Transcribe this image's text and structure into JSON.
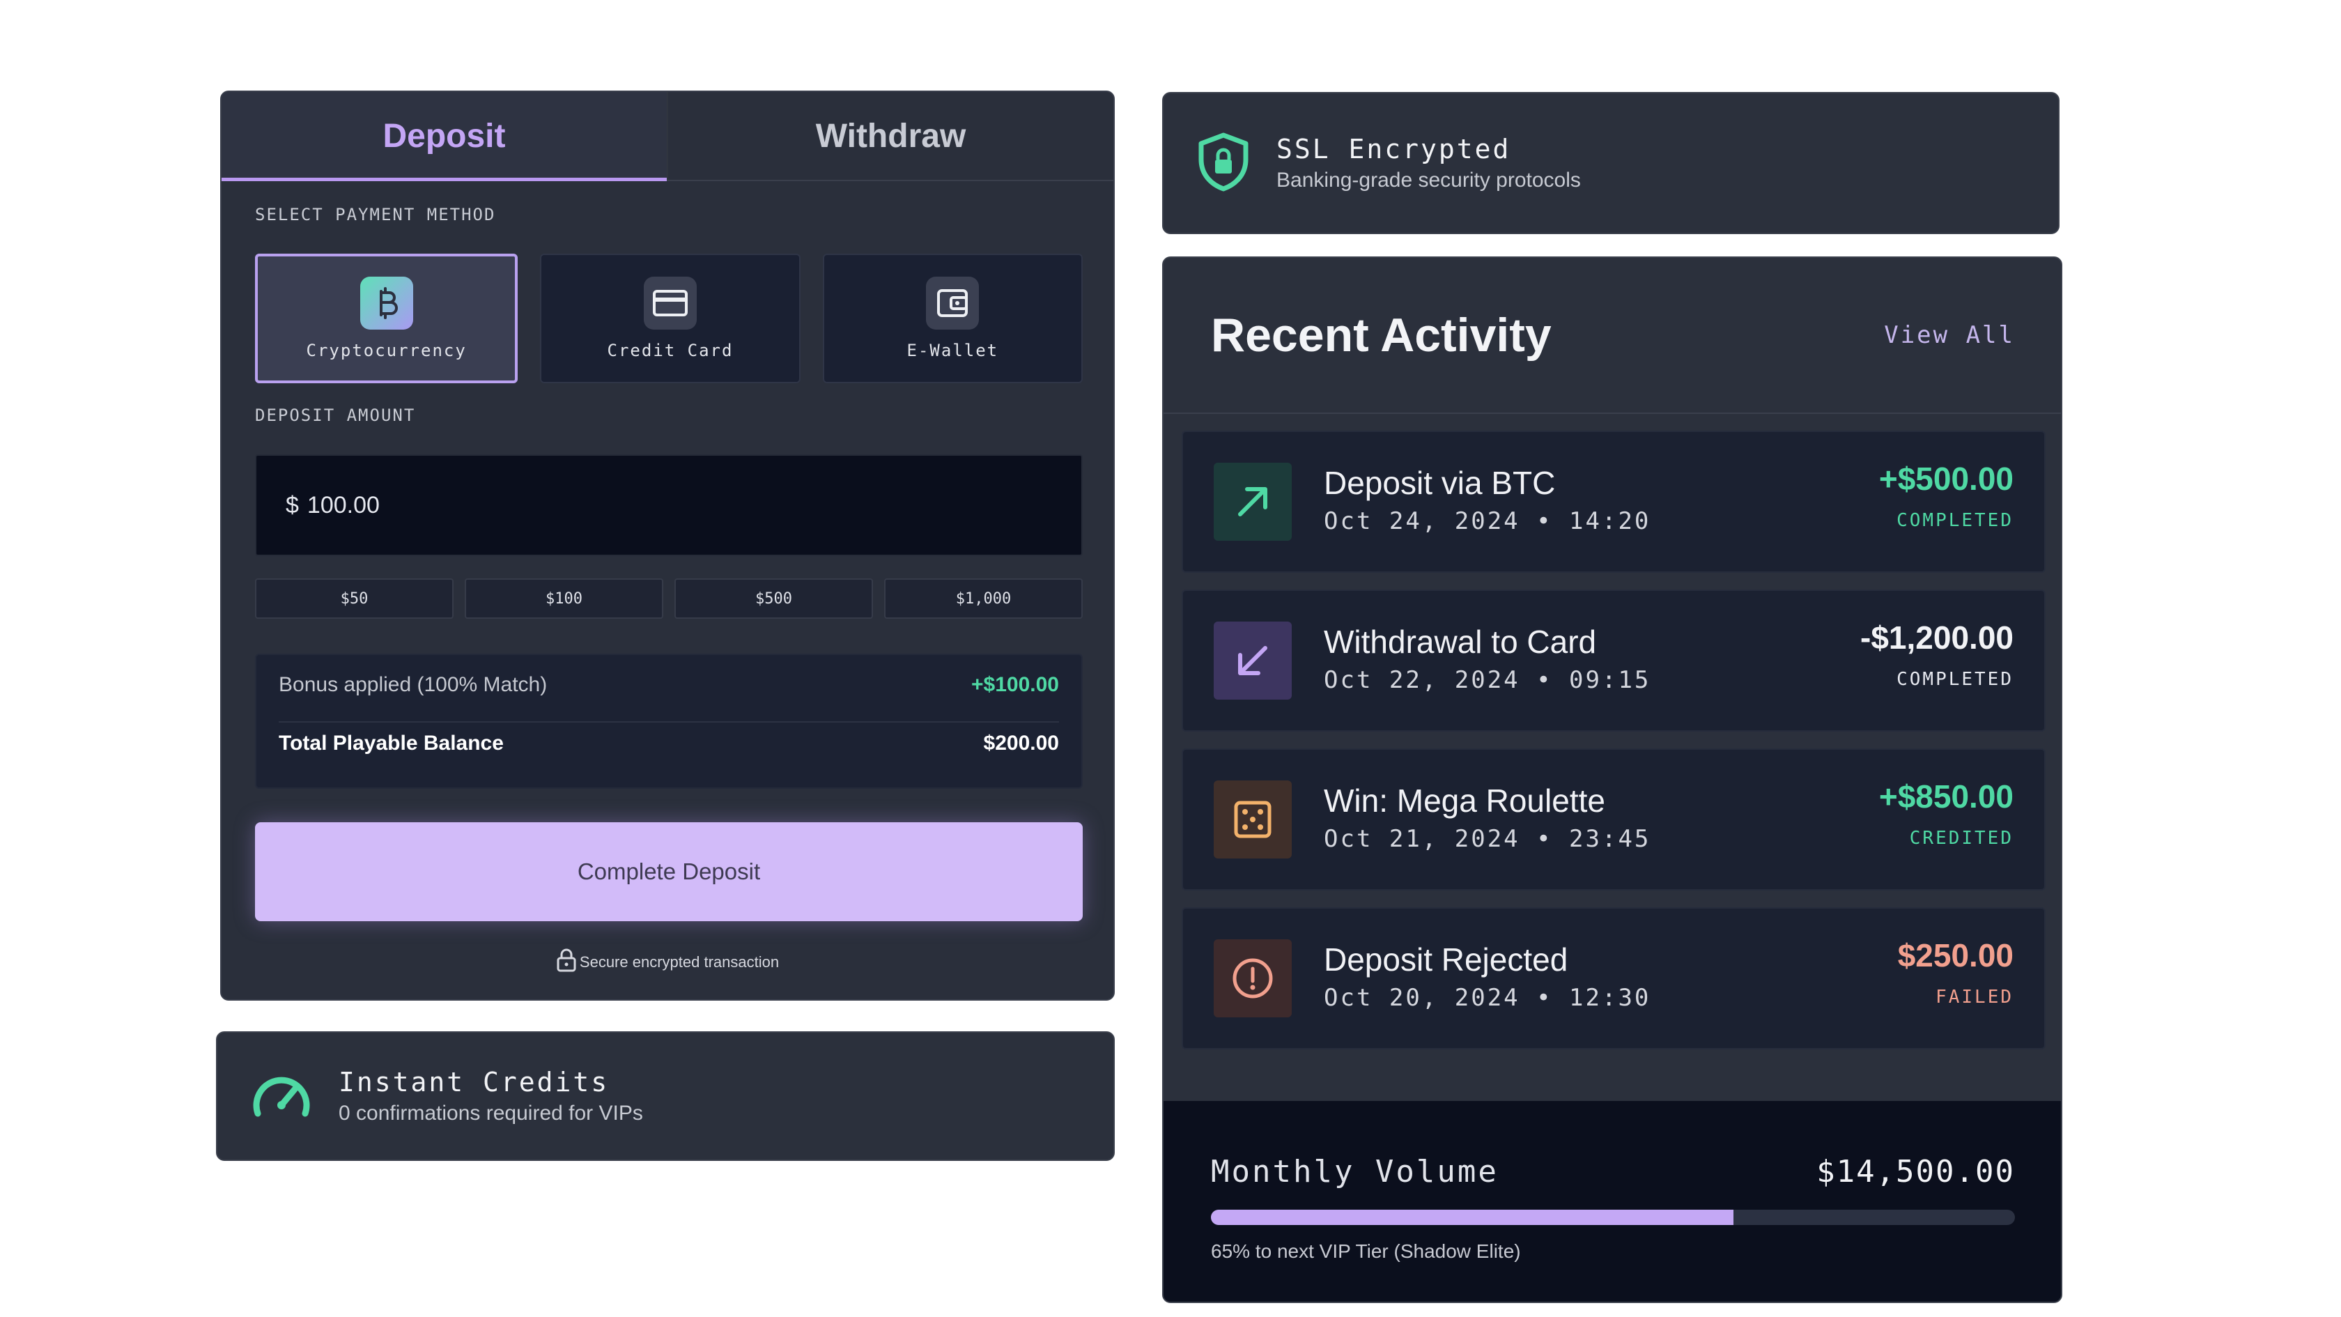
{
  "tabs": {
    "deposit": "Deposit",
    "withdraw": "Withdraw"
  },
  "payment": {
    "label": "SELECT PAYMENT METHOD",
    "methods": [
      {
        "label": "Cryptocurrency",
        "icon": "bitcoin-icon",
        "selected": true
      },
      {
        "label": "Credit Card",
        "icon": "credit-card-icon",
        "selected": false
      },
      {
        "label": "E-Wallet",
        "icon": "wallet-icon",
        "selected": false
      }
    ]
  },
  "amount": {
    "label": "DEPOSIT AMOUNT",
    "currency": "$",
    "value": "100.00",
    "quick": [
      "$50",
      "$100",
      "$500",
      "$1,000"
    ]
  },
  "summary": {
    "bonus_label": "Bonus applied (100% Match)",
    "bonus_value": "+$100.00",
    "total_label": "Total Playable Balance",
    "total_value": "$200.00"
  },
  "cta": "Complete Deposit",
  "secure_note": "Secure encrypted transaction",
  "instant": {
    "title": "Instant Credits",
    "subtitle": "0 confirmations required for VIPs",
    "icon": "speedometer-icon"
  },
  "ssl": {
    "title": "SSL Encrypted",
    "subtitle": "Banking-grade security protocols",
    "icon": "shield-lock-icon"
  },
  "activity": {
    "title": "Recent Activity",
    "view_all": "View All",
    "items": [
      {
        "title": "Deposit via BTC",
        "date": "Oct 24, 2024 • 14:20",
        "amount": "+$500.00",
        "status": "COMPLETED",
        "icon": "arrow-up-right-icon",
        "color": "#4fd9a4"
      },
      {
        "title": "Withdrawal to Card",
        "date": "Oct 22, 2024 • 09:15",
        "amount": "-$1,200.00",
        "status": "COMPLETED",
        "icon": "arrow-down-left-icon",
        "color": "#f2f3f6"
      },
      {
        "title": "Win: Mega Roulette",
        "date": "Oct 21, 2024 • 23:45",
        "amount": "+$850.00",
        "status": "CREDITED",
        "icon": "dice-icon",
        "color": "#4fd9a4"
      },
      {
        "title": "Deposit Rejected",
        "date": "Oct 20, 2024 • 12:30",
        "amount": "$250.00",
        "status": "FAILED",
        "icon": "alert-circle-icon",
        "color": "#f2a08e"
      }
    ]
  },
  "volume": {
    "label": "Monthly Volume",
    "value": "$14,500.00",
    "progress": 0.65,
    "note": "65% to next VIP Tier (Shadow Elite)"
  },
  "colors": {
    "accent": "#c4a6f5",
    "success": "#4fd9a4",
    "danger": "#f2a08e"
  }
}
